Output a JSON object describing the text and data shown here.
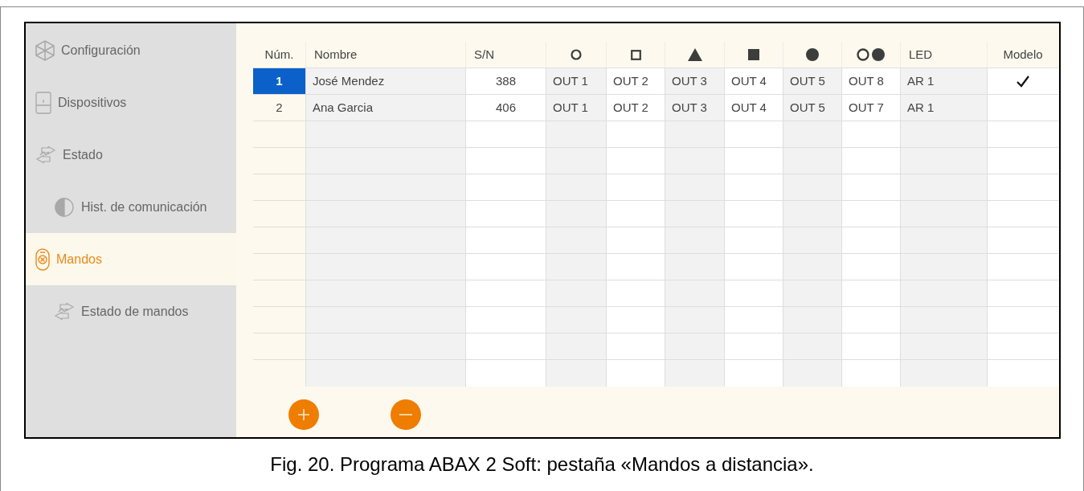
{
  "sidebar": {
    "items": [
      {
        "label": "Configuración",
        "kind": "settings",
        "selected": false
      },
      {
        "label": "Dispositivos",
        "kind": "device",
        "selected": false
      },
      {
        "label": "Estado",
        "kind": "status",
        "selected": false,
        "children": [
          {
            "label": "Hist. de comunicación",
            "kind": "history",
            "selected": false
          }
        ]
      },
      {
        "label": "Mandos",
        "kind": "remote",
        "selected": true,
        "children": [
          {
            "label": "Estado de mandos",
            "kind": "status",
            "selected": false
          }
        ]
      }
    ]
  },
  "table": {
    "columns": [
      {
        "kind": "text",
        "label": "Núm."
      },
      {
        "kind": "text",
        "label": "Nombre"
      },
      {
        "kind": "text",
        "label": "S/N"
      },
      {
        "kind": "circle"
      },
      {
        "kind": "square"
      },
      {
        "kind": "triangle"
      },
      {
        "kind": "filled-square"
      },
      {
        "kind": "dot"
      },
      {
        "kind": "pair"
      },
      {
        "kind": "text",
        "label": "LED"
      },
      {
        "kind": "text",
        "label": "Modelo"
      }
    ],
    "rows": [
      {
        "selected": true,
        "number": "1",
        "name": "José Mendez",
        "sn": "388",
        "outputs": [
          "OUT 1",
          "OUT 2",
          "OUT 3",
          "OUT 4",
          "OUT 5",
          "OUT 8"
        ],
        "led": "AR 1",
        "model": true
      },
      {
        "selected": false,
        "number": "2",
        "name": "Ana Garcia",
        "sn": "406",
        "outputs": [
          "OUT 1",
          "OUT 2",
          "OUT 3",
          "OUT 4",
          "OUT 5",
          "OUT 7"
        ],
        "led": "AR 1",
        "model": false
      }
    ]
  },
  "caption": "Fig. 20. Programa ABAX 2 Soft: pestaña «Mandos a distancia»."
}
